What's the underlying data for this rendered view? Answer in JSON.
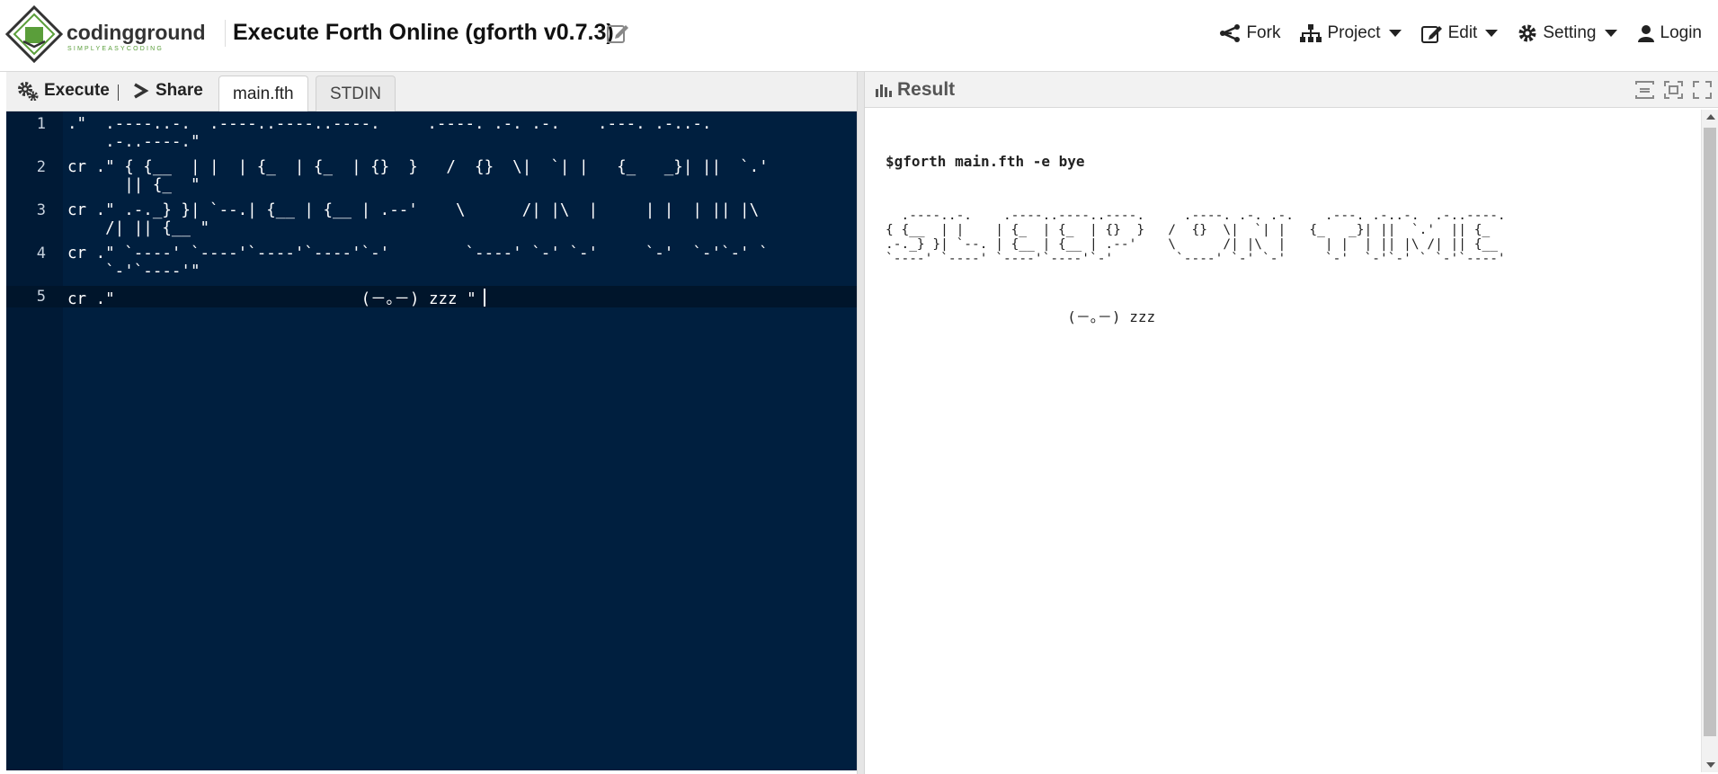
{
  "header": {
    "logo_brand": "codingground",
    "logo_tagline": "SIMPLYEASYCODING",
    "title": "Execute Forth Online (gforth v0.7.3)",
    "nav": {
      "fork": "Fork",
      "project": "Project",
      "edit": "Edit",
      "setting": "Setting",
      "login": "Login"
    }
  },
  "editor": {
    "execute_label": "Execute",
    "share_label": "Share",
    "tabs": [
      {
        "label": "main.fth",
        "active": true
      },
      {
        "label": "STDIN",
        "active": false
      }
    ],
    "lines": [
      {
        "no": "1",
        "text": ".\"  .----..-.  .----..----..----.     .----. .-. .-.    .---. .-..-.\n    .-..----.\""
      },
      {
        "no": "2",
        "text": "cr .\" { {__  | |  | {_  | {_  | {}  }   /  {}  \\|  `| |   {_   _}| ||  `.'\n      || {_  \""
      },
      {
        "no": "3",
        "text": "cr .\" .-._} }| `--.| {__ | {__ | .--'    \\      /| |\\  |     | |  | || |\\\n    /| || {__ \""
      },
      {
        "no": "4",
        "text": "cr .\" `----' `----'`----'`----'`-'        `----' `-' `-'     `-'  `-'`-' `\n    `-'`----'\""
      },
      {
        "no": "5",
        "text": "cr .\"                          (－｡－) zzz \""
      }
    ]
  },
  "result": {
    "title": "Result",
    "command": "$gforth main.fth -e bye",
    "ascii_art": "  .----..-.    .----..----..----.     .----. .-. .-.    .---. .-..-.  .-..----.\n{ {__  | |    | {_  | {_  | {}  }   /  {}  \\|  `| |   {_   _}| ||  `.'  || {_  \n.-._} }| `--. | {__ | {__ | .--'    \\      /| |\\  |     | |  | || |\\ /| || {__ \n`----' `----' `----'`----'`-'        `----' `-' `-'     `-'  `-'`-' ` `-'`----'",
    "sleep_line": "                     (－｡－) zzz"
  },
  "colors": {
    "editor_bg": "#001f3f",
    "logo_green": "#5a9e3a",
    "logo_dark": "#333333"
  }
}
